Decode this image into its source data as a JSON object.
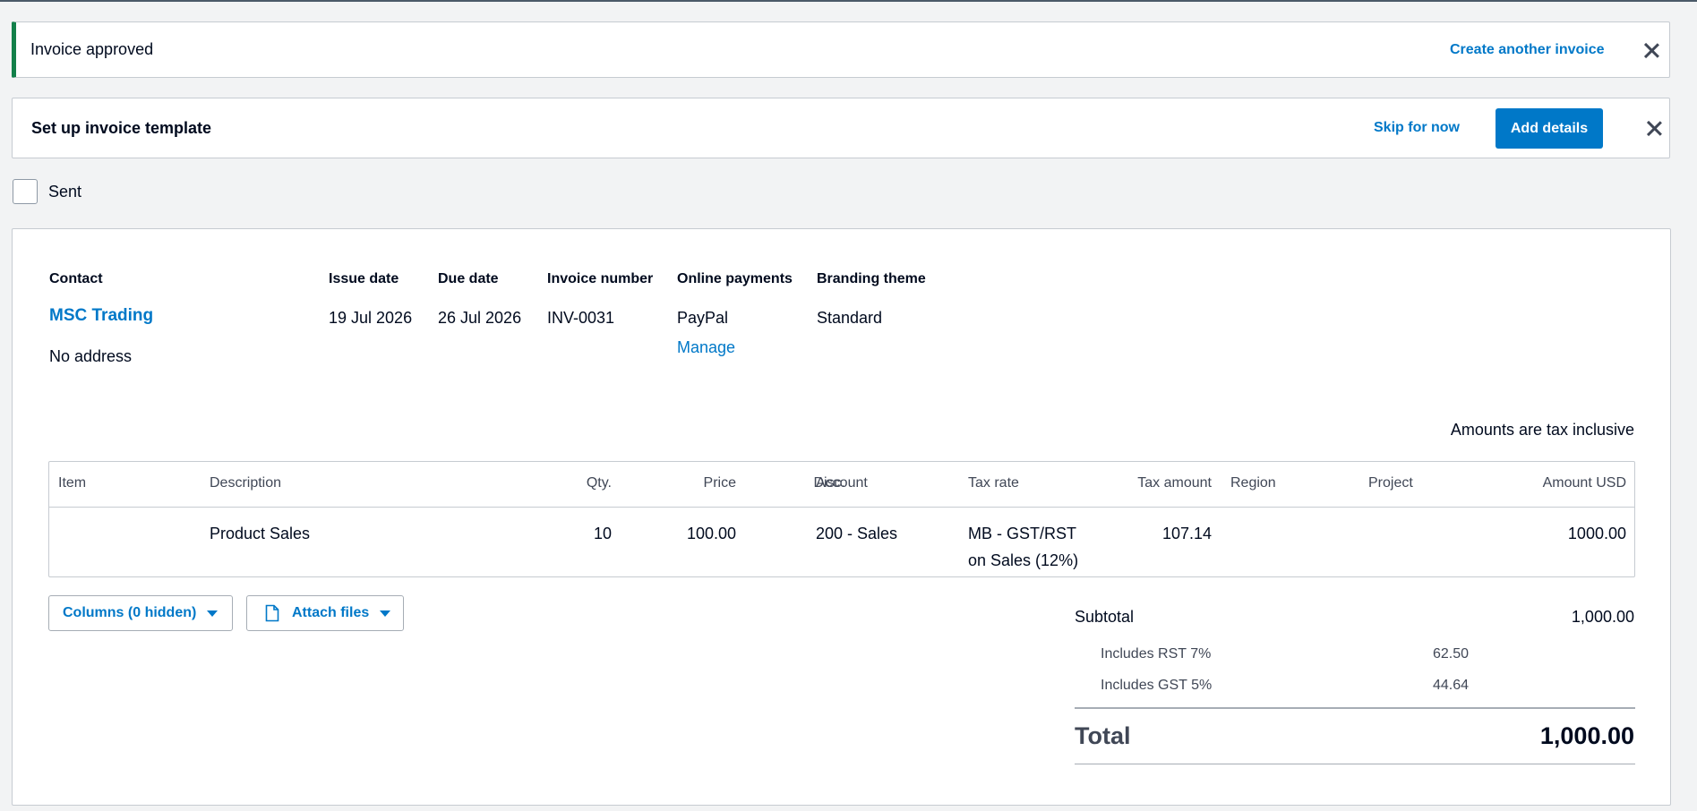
{
  "notifications": {
    "success": {
      "message": "Invoice approved",
      "action_label": "Create another invoice",
      "accent_color": "#13804a"
    },
    "template": {
      "title": "Set up invoice template",
      "skip_label": "Skip for now",
      "add_label": "Add details"
    }
  },
  "status": {
    "sent_label": "Sent",
    "sent_checked": false
  },
  "invoice": {
    "labels": {
      "contact": "Contact",
      "issue_date": "Issue date",
      "due_date": "Due date",
      "invoice_number": "Invoice number",
      "online_payments": "Online payments",
      "branding_theme": "Branding theme"
    },
    "contact_name": "MSC Trading",
    "address": "No address",
    "issue_date": "19 Jul 2026",
    "due_date": "26 Jul 2026",
    "invoice_number": "INV-0031",
    "payment_provider": "PayPal",
    "manage_label": "Manage",
    "branding_theme": "Standard",
    "tax_note": "Amounts are tax inclusive"
  },
  "table": {
    "headers": {
      "item": "Item",
      "description": "Description",
      "qty": "Qty.",
      "price": "Price",
      "disc": "Disc.",
      "account": "Account",
      "tax_rate": "Tax rate",
      "tax_amount": "Tax amount",
      "region": "Region",
      "project": "Project",
      "amount": "Amount USD"
    },
    "rows": [
      {
        "item": "",
        "description": "Product Sales",
        "qty": "10",
        "price": "100.00",
        "disc": "",
        "account": "200 - Sales",
        "tax_rate_line1": "MB - GST/RST",
        "tax_rate_line2": "on Sales (12%)",
        "tax_amount": "107.14",
        "region": "",
        "project": "",
        "amount": "1000.00"
      }
    ]
  },
  "actions": {
    "columns_label": "Columns (0 hidden)",
    "attach_label": "Attach files"
  },
  "summary": {
    "subtotal_label": "Subtotal",
    "subtotal": "1,000.00",
    "taxes": [
      {
        "label": "Includes RST 7%",
        "value": "62.50"
      },
      {
        "label": "Includes GST 5%",
        "value": "44.64"
      }
    ],
    "total_label": "Total",
    "total": "1,000.00"
  },
  "colors": {
    "brand_blue": "#0078c8",
    "success_green": "#13804a"
  }
}
